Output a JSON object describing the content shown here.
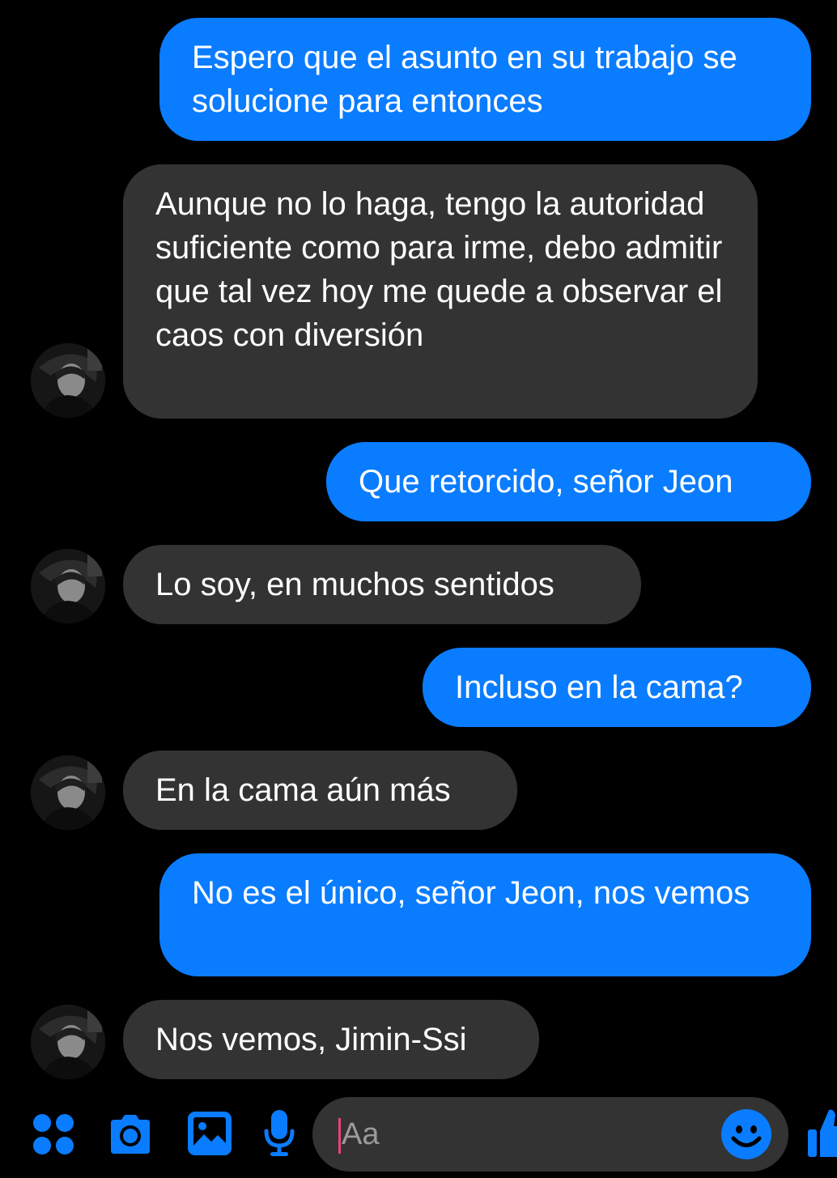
{
  "conversation": {
    "messages": [
      {
        "side": "out",
        "text": "Espero que el asunto en su trabajo se solucione para entonces"
      },
      {
        "side": "in",
        "text": "Aunque no lo haga, tengo la autoridad suficiente como para irme, debo admitir que tal vez hoy me quede a observar el caos con diversión"
      },
      {
        "side": "out",
        "text": "Que retorcido, señor Jeon"
      },
      {
        "side": "in",
        "text": "Lo soy, en muchos sentidos"
      },
      {
        "side": "out",
        "text": "Incluso en la cama?"
      },
      {
        "side": "in",
        "text": "En la cama aún más"
      },
      {
        "side": "out",
        "text": "No es el único, señor Jeon, nos vemos"
      },
      {
        "side": "in",
        "text": "Nos vemos, Jimin-Ssi"
      }
    ]
  },
  "composer": {
    "placeholder": "Aa",
    "icons": [
      "more-apps-icon",
      "camera-icon",
      "gallery-icon",
      "microphone-icon",
      "emoji-icon",
      "thumbs-up-icon"
    ]
  },
  "colors": {
    "background": "#000000",
    "outgoing_bubble": "#0a7cff",
    "incoming_bubble": "#333333",
    "accent": "#0a7cff",
    "caret": "#e8437a"
  }
}
